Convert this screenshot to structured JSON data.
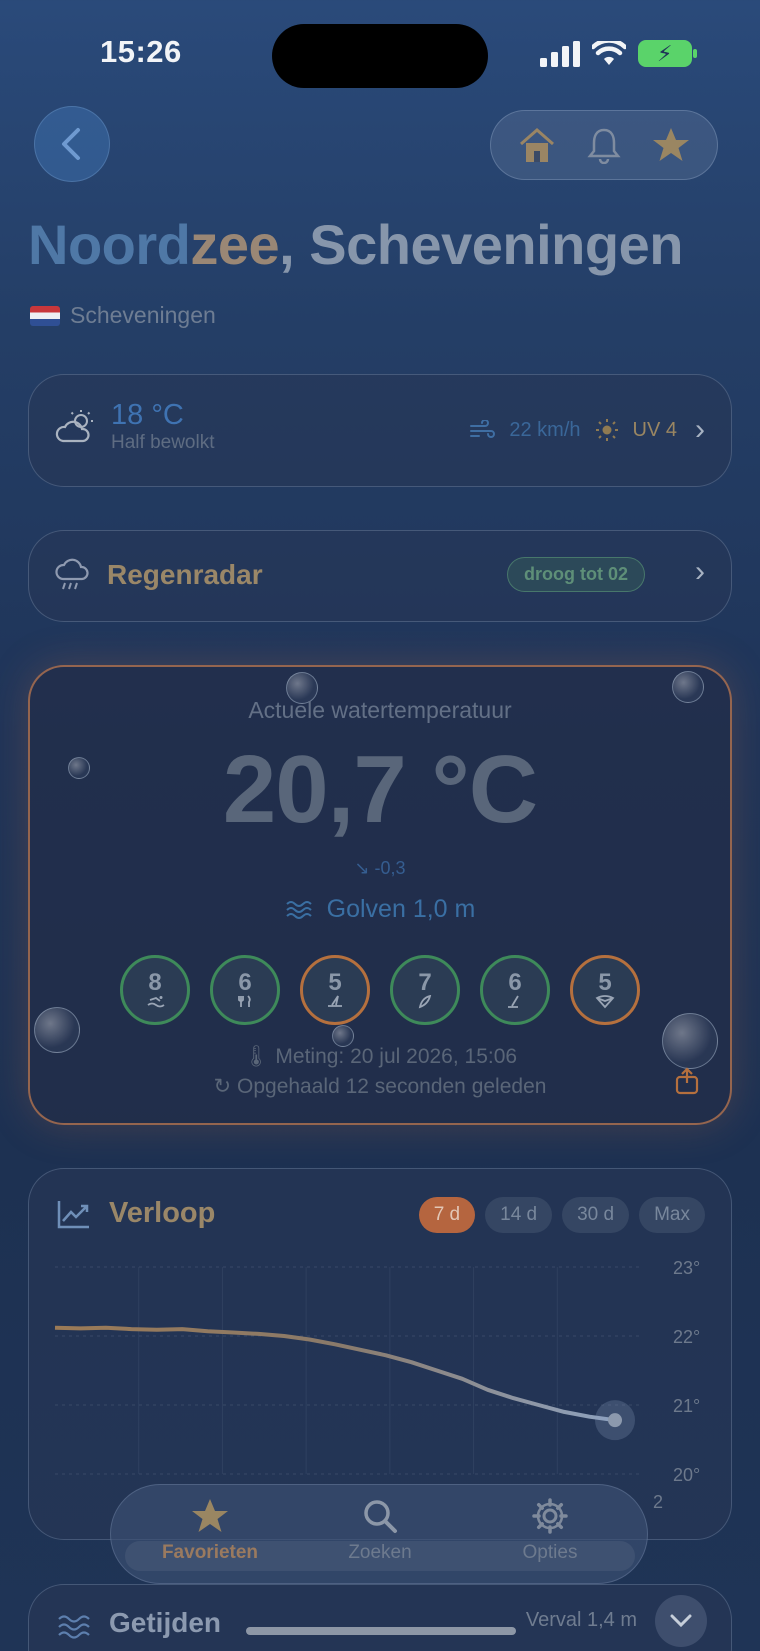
{
  "status": {
    "time": "15:26"
  },
  "title": {
    "part1": "Noord",
    "part2": "zee",
    "part3": ", Scheveningen"
  },
  "subtitle": "Scheveningen",
  "weather": {
    "temp": "18 °C",
    "desc": "Half bewolkt",
    "wind": "22 km/h",
    "uv": "UV 4"
  },
  "radar": {
    "title": "Regenradar",
    "badge": "droog tot 02"
  },
  "water": {
    "label": "Actuele watertemperatuur",
    "temp": "20,7 °C",
    "delta": "↘ -0,3",
    "waves": "Golven 1,0 m",
    "scores": [
      {
        "value": "8",
        "icon": "swimmer-icon",
        "color": "#3e8a5a"
      },
      {
        "value": "6",
        "icon": "fork-knife-icon",
        "color": "#3e8a5a"
      },
      {
        "value": "5",
        "icon": "windsurf-icon",
        "color": "#b5703e"
      },
      {
        "value": "7",
        "icon": "surfboard-icon",
        "color": "#3e8a5a"
      },
      {
        "value": "6",
        "icon": "sup-paddle-icon",
        "color": "#3e8a5a"
      },
      {
        "value": "5",
        "icon": "kite-icon",
        "color": "#b5703e"
      }
    ],
    "measurement": "Meting: 20 jul 2026, 15:06",
    "fetched": "Opgehaald 12 seconden geleden"
  },
  "chart": {
    "title": "Verloop",
    "ranges": [
      "7 d",
      "14 d",
      "30 d",
      "Max"
    ],
    "active_range": "7 d"
  },
  "chart_data": {
    "type": "line",
    "ylim": [
      20,
      23
    ],
    "yticks": [
      "23°",
      "22°",
      "21°",
      "20°"
    ],
    "extra_label": "2",
    "series": [
      {
        "values": [
          22.12,
          22.11,
          22.12,
          22.1,
          22.09,
          22.1,
          22.07,
          22.05,
          22.03,
          22.0,
          21.95,
          21.88,
          21.8,
          21.72,
          21.62,
          21.5,
          21.38,
          21.22,
          21.1,
          21.0,
          20.9,
          20.83,
          20.78
        ]
      }
    ]
  },
  "tabs": [
    {
      "label": "Favorieten",
      "icon": "star-icon"
    },
    {
      "label": "Zoeken",
      "icon": "search-icon"
    },
    {
      "label": "Opties",
      "icon": "gear-icon"
    }
  ],
  "tides": {
    "title": "Getijden",
    "range": "Verval 1,4 m"
  },
  "colors": {
    "accent": "#b5653f",
    "good": "#3e8a5a",
    "warn": "#b5703e",
    "blue": "#3f73b2"
  }
}
